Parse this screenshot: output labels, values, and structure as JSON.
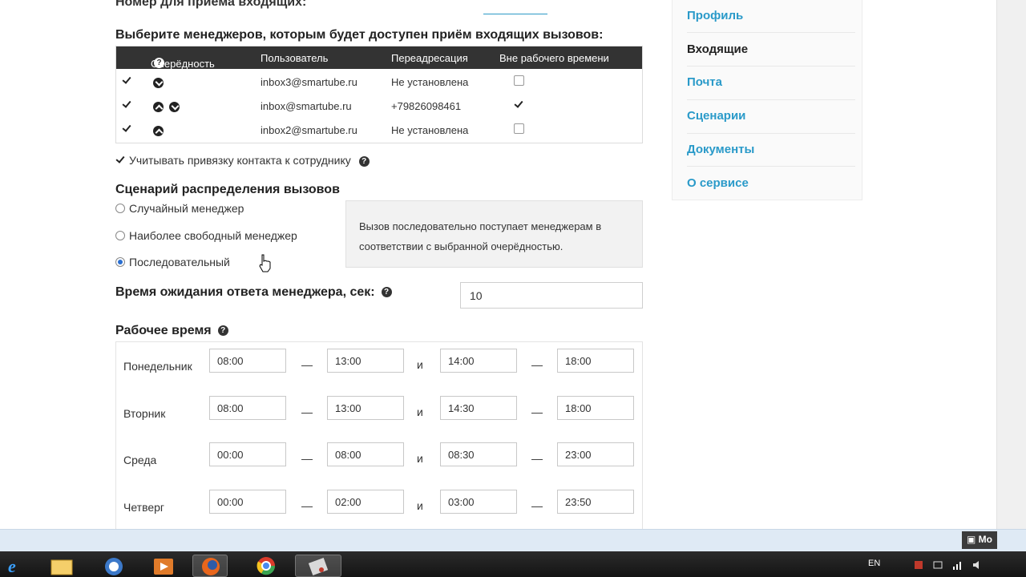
{
  "top": {
    "cut_heading": "Номер для приёма входящих:"
  },
  "managers": {
    "title": "Выберите менеджеров, которым будет доступен приём входящих вызовов:",
    "columns": [
      "Очерёдность",
      "Пользователь",
      "Переадресация",
      "Вне рабочего времени"
    ],
    "rows": [
      {
        "user": "inbox3@smartube.ru",
        "forward": "Не установлена",
        "selected": true,
        "after_hours": false
      },
      {
        "user": "inbox@smartube.ru",
        "forward": "+79826098461",
        "selected": true,
        "after_hours": true
      },
      {
        "user": "inbox2@smartube.ru",
        "forward": "Не установлена",
        "selected": true,
        "after_hours": false
      }
    ],
    "bind_contact_label": "Учитывать привязку контакта к сотруднику"
  },
  "scenario": {
    "title": "Сценарий распределения вызовов",
    "options": [
      "Случайный менеджер",
      "Наиболее свободный менеджер",
      "Последовательный"
    ],
    "selected": "Последовательный",
    "description": "Вызов последовательно поступает менеджерам в соответствии с выбранной очерёдностью."
  },
  "wait": {
    "label": "Время ожидания ответа менеджера, сек:",
    "value": "10"
  },
  "work_time": {
    "title": "Рабочее время",
    "and_label": "и",
    "dash": "—",
    "days": [
      {
        "name": "Понедельник",
        "times": [
          "08:00",
          "13:00",
          "14:00",
          "18:00"
        ]
      },
      {
        "name": "Вторник",
        "times": [
          "08:00",
          "13:00",
          "14:30",
          "18:00"
        ]
      },
      {
        "name": "Среда",
        "times": [
          "00:00",
          "08:00",
          "08:30",
          "23:00"
        ]
      },
      {
        "name": "Четверг",
        "times": [
          "00:00",
          "02:00",
          "03:00",
          "23:50"
        ]
      }
    ]
  },
  "sidebar": {
    "items": [
      "Профиль",
      "Входящие",
      "Почта",
      "Сценарии",
      "Документы",
      "О сервисе"
    ],
    "active": "Входящие"
  },
  "taskbar": {
    "strip_button": "Mo",
    "lang": "EN"
  },
  "colors": {
    "link": "#2a9ac9",
    "table_header": "#333333",
    "taskbar": "#1c1c1c"
  }
}
